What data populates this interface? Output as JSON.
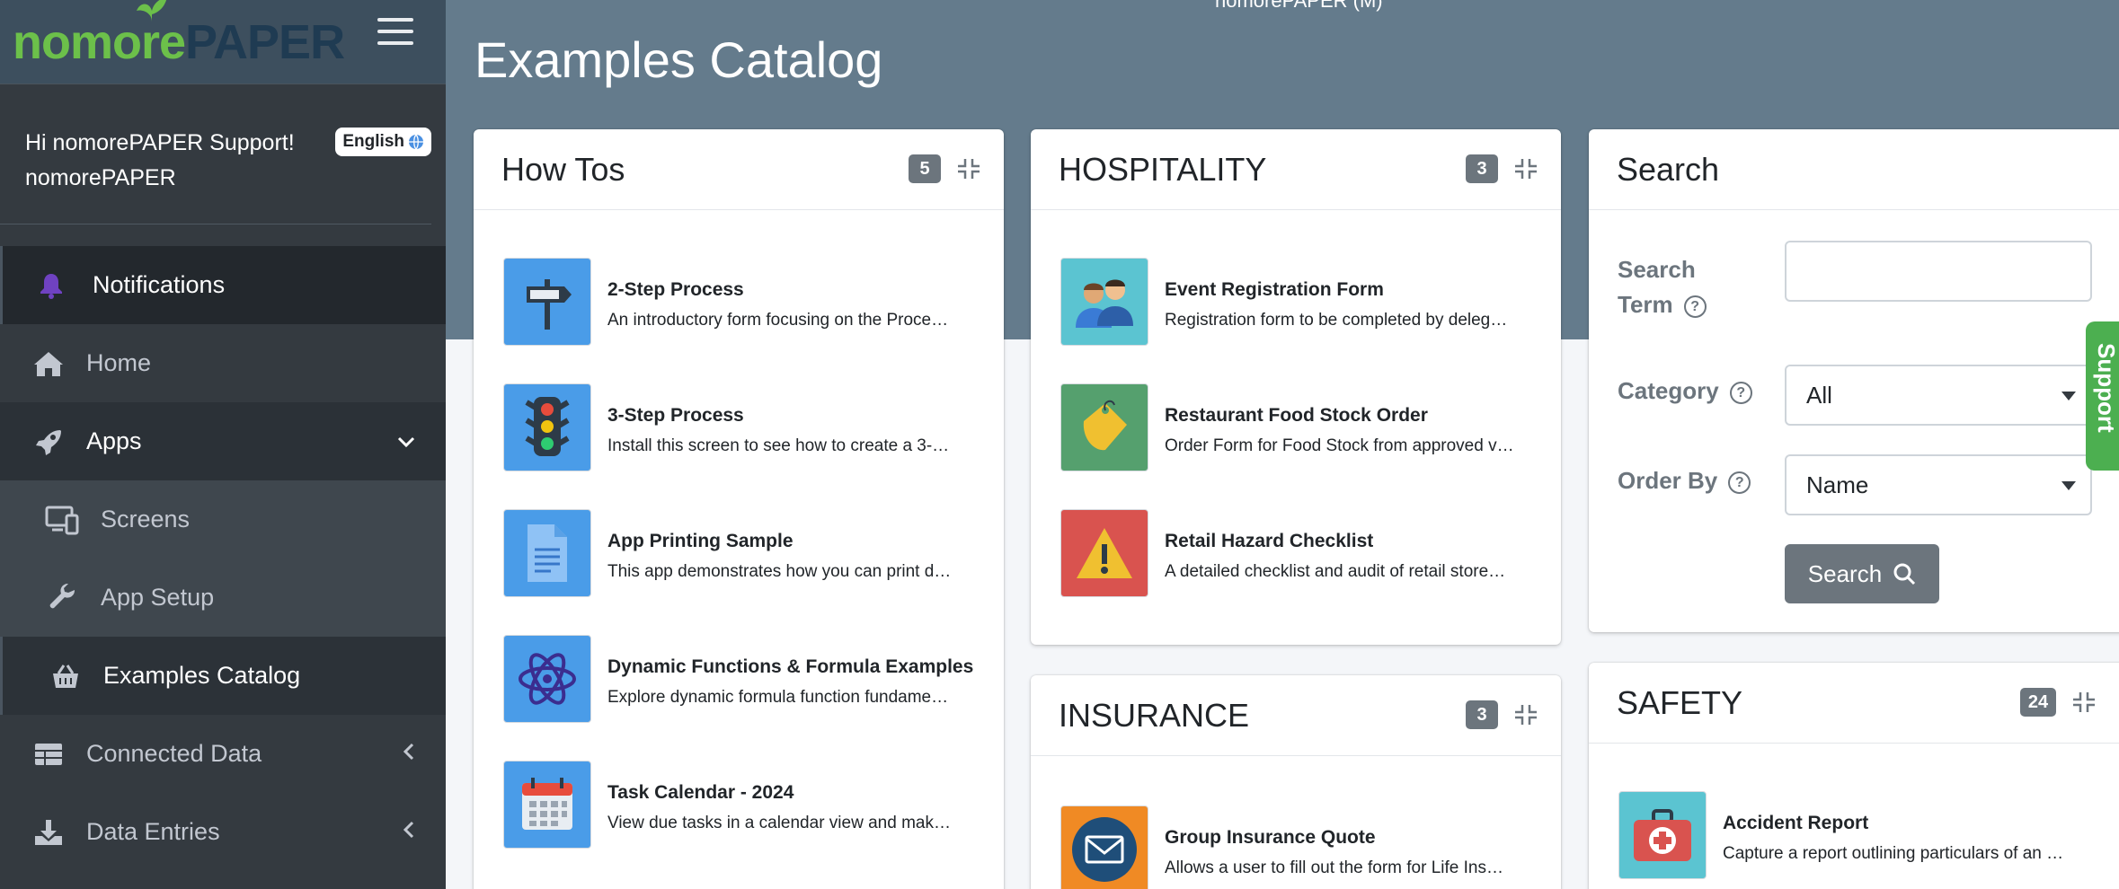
{
  "brand": {
    "logo_part1": "nomore",
    "logo_part2": "PAPER"
  },
  "sidebar": {
    "user_greeting": "Hi nomorePAPER Support!",
    "user_org": "nomorePAPER",
    "language_label": "English",
    "items": [
      {
        "label": "Notifications",
        "icon": "bell-icon"
      },
      {
        "label": "Home",
        "icon": "home-icon"
      },
      {
        "label": "Apps",
        "icon": "rocket-icon"
      },
      {
        "label": "Screens",
        "icon": "screens-icon"
      },
      {
        "label": "App Setup",
        "icon": "wrench-icon"
      },
      {
        "label": "Examples Catalog",
        "icon": "basket-icon"
      },
      {
        "label": "Connected Data",
        "icon": "table-icon"
      },
      {
        "label": "Data Entries",
        "icon": "download-icon"
      }
    ]
  },
  "header": {
    "top_user": "nomorePAPER (M)",
    "page_title": "Examples Catalog"
  },
  "cards": {
    "howtos": {
      "title": "How Tos",
      "count": "5",
      "items": [
        {
          "title": "2-Step Process",
          "desc": "An introductory form focusing on the Proce…",
          "icon": "signpost-icon"
        },
        {
          "title": "3-Step Process",
          "desc": "Install this screen to see how to create a 3-…",
          "icon": "traffic-light-icon"
        },
        {
          "title": "App Printing Sample",
          "desc": "This app demonstrates how you can print d…",
          "icon": "document-icon"
        },
        {
          "title": "Dynamic Functions & Formula Examples",
          "desc": "Explore dynamic formula function fundame…",
          "icon": "atom-icon"
        },
        {
          "title": "Task Calendar - 2024",
          "desc": "View due tasks in a calendar view and mak…",
          "icon": "calendar-icon"
        }
      ]
    },
    "hospitality": {
      "title": "HOSPITALITY",
      "count": "3",
      "items": [
        {
          "title": "Event Registration Form",
          "desc": "Registration form to be completed by deleg…",
          "icon": "people-icon"
        },
        {
          "title": "Restaurant Food Stock Order",
          "desc": "Order Form for Food Stock from approved v…",
          "icon": "tag-icon"
        },
        {
          "title": "Retail Hazard Checklist",
          "desc": "A detailed checklist and audit of retail store…",
          "icon": "warning-icon"
        }
      ]
    },
    "insurance": {
      "title": "INSURANCE",
      "count": "3",
      "items": [
        {
          "title": "Group Insurance Quote",
          "desc": "Allows a user to fill out the form for Life Ins…",
          "icon": "envelope-icon"
        }
      ]
    },
    "safety": {
      "title": "SAFETY",
      "count": "24",
      "items": [
        {
          "title": "Accident Report",
          "desc": "Capture a report outlining particulars of an …",
          "icon": "first-aid-icon"
        }
      ]
    }
  },
  "search": {
    "title": "Search",
    "term_label_1": "Search",
    "term_label_2": "Term",
    "term_value": "",
    "category_label": "Category",
    "category_value": "All",
    "order_label": "Order By",
    "order_value": "Name",
    "button_label": "Search",
    "help_glyph": "?"
  },
  "support_tab": {
    "label": "Support"
  },
  "colors": {
    "hero": "#647b8c",
    "sidebar": "#343a40",
    "accent_green": "#6cc04a",
    "badge": "#6c757d",
    "notif_bell": "#6f42c1"
  }
}
